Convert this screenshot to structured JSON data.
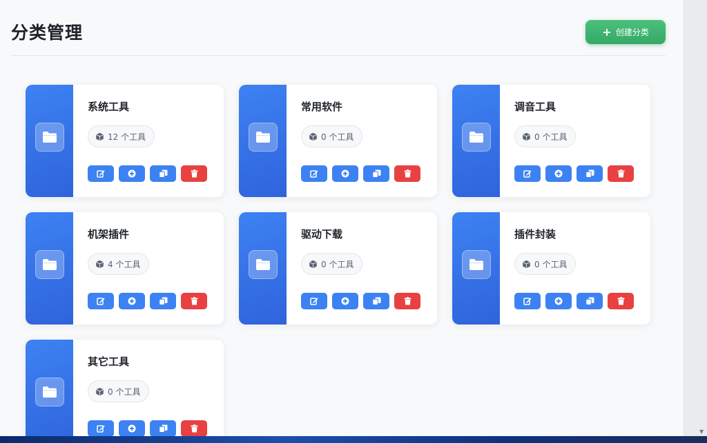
{
  "header": {
    "title": "分类管理",
    "create_label": "创建分类"
  },
  "categories": [
    {
      "name": "系统工具",
      "count_text": "12 个工具"
    },
    {
      "name": "常用软件",
      "count_text": "0 个工具"
    },
    {
      "name": "调音工具",
      "count_text": "0 个工具"
    },
    {
      "name": "机架插件",
      "count_text": "4 个工具"
    },
    {
      "name": "驱动下载",
      "count_text": "0 个工具"
    },
    {
      "name": "插件封装",
      "count_text": "0 个工具"
    },
    {
      "name": "其它工具",
      "count_text": "0 个工具"
    }
  ],
  "colors": {
    "accent_blue": "#3c82f2",
    "create_green": "#34a866",
    "delete_red": "#e84141"
  },
  "icons": {
    "card": "folder-icon",
    "count": "box-icon",
    "actions": [
      "edit-icon",
      "add-circle-icon",
      "copy-icon",
      "trash-icon"
    ]
  }
}
